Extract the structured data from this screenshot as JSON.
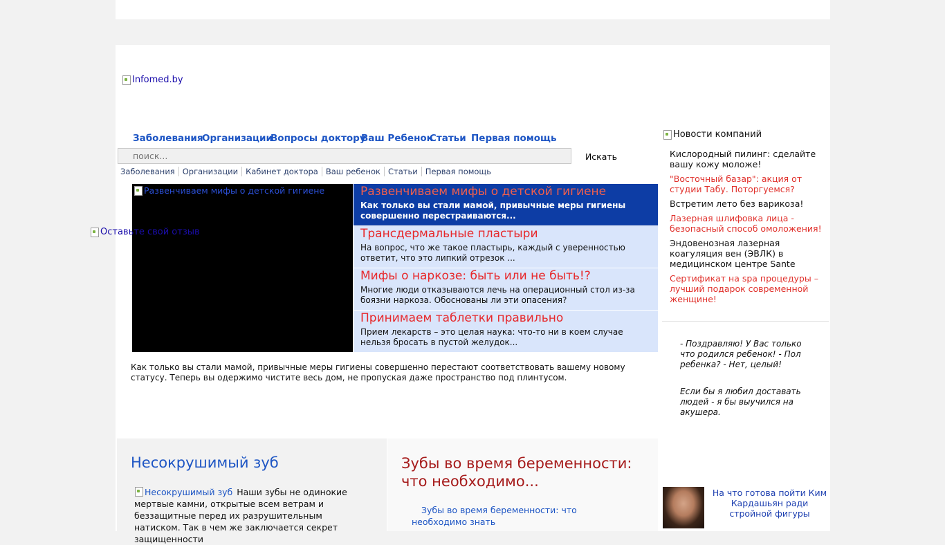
{
  "header": {
    "logo_alt": "Infomed.by",
    "feedback_alt": "Оставьте свой отзыв"
  },
  "nav": {
    "items": [
      "Заболевания",
      "Организации",
      "Вопросы доктору",
      "Ваш Ребенок",
      "Статьи",
      "Первая помощь"
    ]
  },
  "search": {
    "placeholder": "поиск...",
    "button_label": "Искать"
  },
  "subnav": {
    "items": [
      "Заболевания",
      "Организации",
      "Кабинет доктора",
      "Ваш ребенок",
      "Статьи",
      "Первая помощь"
    ]
  },
  "slider": {
    "image_alt": "Развенчиваем мифы о детской гигиене",
    "slides": [
      {
        "title": "Развенчиваем мифы о детской гигиене",
        "desc": "Как только вы стали мамой, привычные меры гигиены совершенно перестраиваются..."
      },
      {
        "title": "Трансдермальные пластыри",
        "desc": "На вопрос, что же такое пластырь, каждый с уверенностью ответит, что это липкий отрезок ..."
      },
      {
        "title": "Мифы о наркозе: быть или не быть!?",
        "desc": "Многие люди отказываются лечь на операционный стол из-за боязни наркоза. Обоснованы ли эти опасения?"
      },
      {
        "title": "Принимаем таблетки правильно",
        "desc": "Прием лекарств – это целая наука: что-то ни в коем случае нельзя бросать в пустой желудок..."
      }
    ],
    "lead": "Как только вы стали мамой, привычные меры гигиены совершенно перестают соответствовать вашему новому статусу. Теперь вы одержимо чистите весь дом, не пропуская даже пространство под плинтусом."
  },
  "articles": {
    "left": {
      "title": "Несокрушимый зуб",
      "image_alt": "Несокрушимый зуб",
      "text": "Наши зубы не одинокие мертвые камни, открытые всем ветрам и беззащитные перед их разрушительным натиском. Так в чем же заключается секрет защищенности"
    },
    "right": {
      "title": "Зубы во время беременности: что необходимо...",
      "image_alt": "Зубы во время беременности: что необходимо знать"
    }
  },
  "sidebar": {
    "news_header_alt": "Новости компаний",
    "news": [
      {
        "text": "Кислородный пилинг: сделайте вашу кожу моложе!",
        "color": "#111111"
      },
      {
        "text": "\"Восточный базар\": акция от студии Табу. Поторгуемся?",
        "color": "#e0302b"
      },
      {
        "text": "Встретим лето без варикоза!",
        "color": "#111111"
      },
      {
        "text": "Лазерная шлифовка лица - безопасный способ омоложения!",
        "color": "#e0302b"
      },
      {
        "text": "Эндовенозная лазерная коагуляция вен (ЭВЛК) в медицинском центре Sante",
        "color": "#111111"
      },
      {
        "text": "Сертификат на spa процедуры – лучший подарок современной женщине!",
        "color": "#e0302b"
      }
    ],
    "jokes": [
      "- Поздравляю! У Вас только что родился ребенок! - Пол ребенка? - Нет, целый!",
      "Если бы я любил доставать людей - я бы выучился на акушера."
    ],
    "promo": {
      "image_name": "celebrity-photo",
      "text": "На что готова пойти Ким Кардашьян ради стройной фигуры"
    }
  },
  "colors": {
    "nav_link": "#1d55c4",
    "slide_active_bg": "#0d3da5",
    "slide_bg": "#d9e5fb",
    "slide_title": "#e7282b",
    "accent_red": "#e0302b"
  }
}
